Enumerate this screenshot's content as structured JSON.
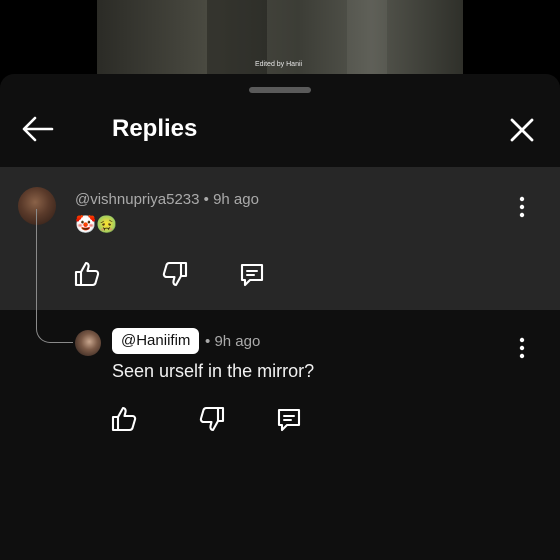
{
  "video": {
    "watermark": "Edited by Hanii"
  },
  "header": {
    "title": "Replies"
  },
  "comment": {
    "author": "@vishnupriya5233",
    "time": "9h ago",
    "emojis": "🤡🤢"
  },
  "reply": {
    "author": "@Haniifim",
    "time": "9h ago",
    "text": "Seen urself in the mirror?"
  },
  "separator": "•"
}
